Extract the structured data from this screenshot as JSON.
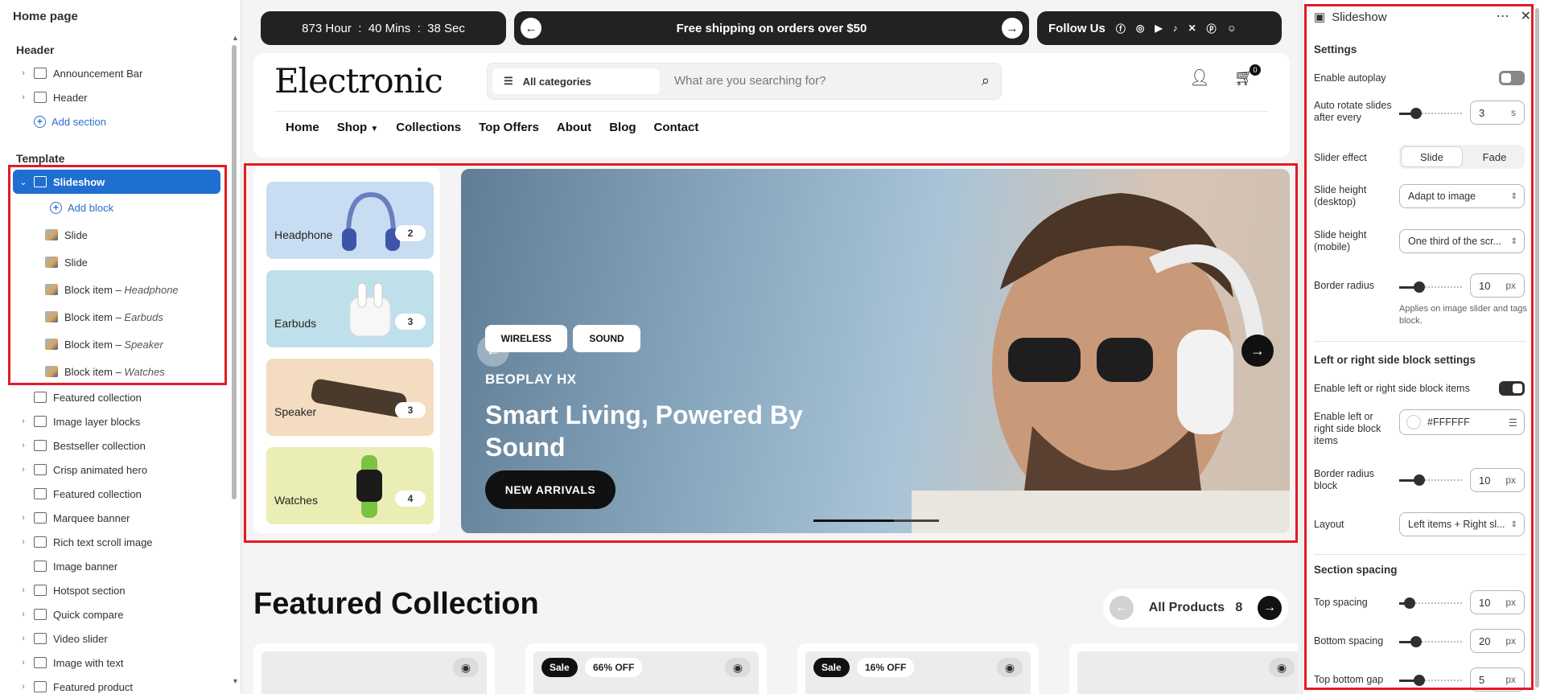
{
  "left_panel": {
    "title": "Home page",
    "header_group": {
      "title": "Header",
      "items": [
        {
          "label": "Announcement Bar"
        },
        {
          "label": "Header"
        }
      ],
      "add_label": "Add section"
    },
    "template_group": {
      "title": "Template",
      "selected_label": "Slideshow",
      "add_block_label": "Add block",
      "blocks": [
        {
          "label": "Slide",
          "detail": ""
        },
        {
          "label": "Slide",
          "detail": ""
        },
        {
          "label": "Block item – ",
          "detail": "Headphone"
        },
        {
          "label": "Block item – ",
          "detail": "Earbuds"
        },
        {
          "label": "Block item – ",
          "detail": "Speaker"
        },
        {
          "label": "Block item – ",
          "detail": "Watches"
        }
      ],
      "sections": [
        {
          "label": "Featured collection"
        },
        {
          "label": "Image layer blocks"
        },
        {
          "label": "Bestseller collection"
        },
        {
          "label": "Crisp animated hero"
        },
        {
          "label": "Featured collection"
        },
        {
          "label": "Marquee banner"
        },
        {
          "label": "Rich text scroll image"
        },
        {
          "label": "Image banner"
        },
        {
          "label": "Hotspot section"
        },
        {
          "label": "Quick compare"
        },
        {
          "label": "Video slider"
        },
        {
          "label": "Image with text"
        },
        {
          "label": "Featured product"
        }
      ]
    }
  },
  "store": {
    "timer": {
      "hours": "873",
      "hour_label": "Hour",
      "mins": "40",
      "mins_label": "Mins",
      "secs": "38",
      "secs_label": "Sec"
    },
    "announcement": "Free shipping on orders over $50",
    "follow_label": "Follow Us",
    "logo": "Electronic",
    "search": {
      "category": "All categories",
      "placeholder": "What are you searching for?"
    },
    "cart_count": "0",
    "nav": [
      "Home",
      "Shop",
      "Collections",
      "Top Offers",
      "About",
      "Blog",
      "Contact"
    ],
    "categories": [
      {
        "name": "Headphone",
        "count": "2",
        "bg": "#c9ddf2"
      },
      {
        "name": "Earbuds",
        "count": "3",
        "bg": "#bfe0ea"
      },
      {
        "name": "Speaker",
        "count": "3",
        "bg": "#f3dcc0"
      },
      {
        "name": "Watches",
        "count": "4",
        "bg": "#eaeeb4"
      }
    ],
    "hero": {
      "tags": [
        "WIRELESS",
        "SOUND"
      ],
      "subtitle": "BEOPLAY HX",
      "title": "Smart Living, Powered By Sound",
      "button": "NEW ARRIVALS"
    },
    "featured": {
      "title": "Featured Collection",
      "all_products_label": "All Products",
      "all_products_count": "8",
      "products": [
        {
          "sale": "",
          "off": ""
        },
        {
          "sale": "Sale",
          "off": "66% OFF"
        },
        {
          "sale": "Sale",
          "off": "16% OFF"
        },
        {
          "sale": "",
          "off": ""
        }
      ]
    }
  },
  "right_panel": {
    "title": "Slideshow",
    "settings_title": "Settings",
    "enable_autoplay": {
      "label": "Enable autoplay",
      "on": false
    },
    "auto_rotate": {
      "label": "Auto rotate slides after every",
      "value": "3",
      "unit": "s"
    },
    "slider_effect": {
      "label": "Slider effect",
      "options": [
        "Slide",
        "Fade"
      ],
      "selected": "Slide"
    },
    "slide_height_desktop": {
      "label": "Slide height (desktop)",
      "value": "Adapt to image"
    },
    "slide_height_mobile": {
      "label": "Slide height (mobile)",
      "value": "One third of the scr..."
    },
    "border_radius": {
      "label": "Border radius",
      "value": "10",
      "unit": "px",
      "help": "Applies on image slider and tags block."
    },
    "side_block_title": "Left or right side block settings",
    "enable_side_items": {
      "label": "Enable left or right side block items",
      "on": true
    },
    "side_color": {
      "label": "Enable left or right side block items",
      "value": "#FFFFFF"
    },
    "border_radius_block": {
      "label": "Border radius block",
      "value": "10",
      "unit": "px"
    },
    "layout": {
      "label": "Layout",
      "value": "Left items + Right sl..."
    },
    "spacing_title": "Section spacing",
    "top_spacing": {
      "label": "Top spacing",
      "value": "10",
      "unit": "px"
    },
    "bottom_spacing": {
      "label": "Bottom spacing",
      "value": "20",
      "unit": "px"
    },
    "top_bottom_gap": {
      "label": "Top bottom gap",
      "value": "5",
      "unit": "px"
    }
  }
}
